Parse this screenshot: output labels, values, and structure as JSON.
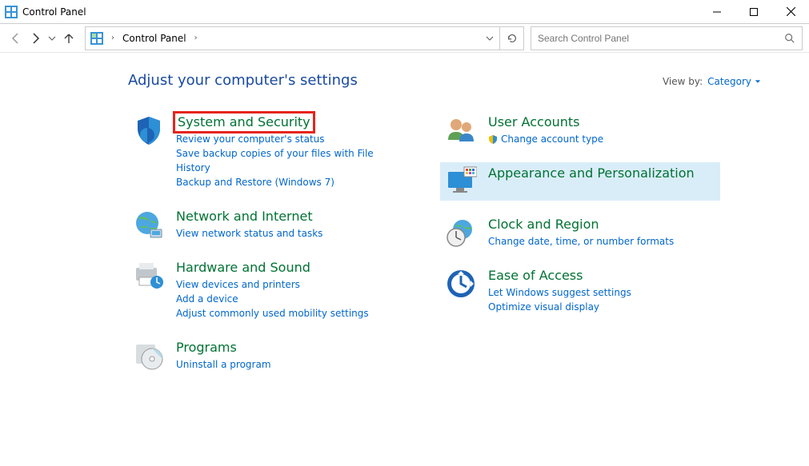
{
  "window": {
    "title": "Control Panel"
  },
  "breadcrumb": {
    "root": "Control Panel"
  },
  "search": {
    "placeholder": "Search Control Panel"
  },
  "heading": "Adjust your computer's settings",
  "viewby": {
    "label": "View by:",
    "value": "Category"
  },
  "cats": {
    "system": {
      "title": "System and Security",
      "subs": [
        "Review your computer's status",
        "Save backup copies of your files with File History",
        "Backup and Restore (Windows 7)"
      ]
    },
    "network": {
      "title": "Network and Internet",
      "subs": [
        "View network status and tasks"
      ]
    },
    "hardware": {
      "title": "Hardware and Sound",
      "subs": [
        "View devices and printers",
        "Add a device",
        "Adjust commonly used mobility settings"
      ]
    },
    "programs": {
      "title": "Programs",
      "subs": [
        "Uninstall a program"
      ]
    },
    "users": {
      "title": "User Accounts",
      "subs": [
        "Change account type"
      ]
    },
    "appearance": {
      "title": "Appearance and Personalization"
    },
    "clock": {
      "title": "Clock and Region",
      "subs": [
        "Change date, time, or number formats"
      ]
    },
    "ease": {
      "title": "Ease of Access",
      "subs": [
        "Let Windows suggest settings",
        "Optimize visual display"
      ]
    }
  }
}
